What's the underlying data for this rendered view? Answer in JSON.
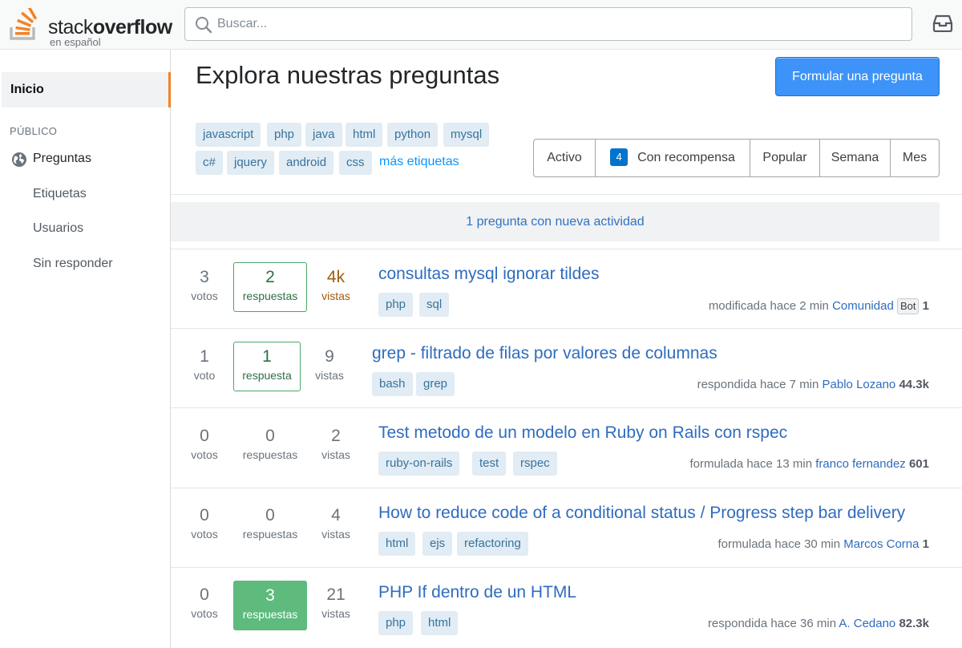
{
  "header": {
    "logo_text_light": "stack",
    "logo_text_bold": "overflow",
    "logo_sub": "en español",
    "search_placeholder": "Buscar...",
    "icons": [
      "search-icon",
      "inbox-icon"
    ]
  },
  "sidebar": {
    "home": "Inicio",
    "section": "PÚBLICO",
    "items": [
      "Preguntas",
      "Etiquetas",
      "Usuarios",
      "Sin responder"
    ]
  },
  "main": {
    "title": "Explora nuestras preguntas",
    "ask_button": "Formular una pregunta",
    "popular_tags": [
      "javascript",
      "php",
      "java",
      "html",
      "python",
      "mysql",
      "c#",
      "jquery",
      "android",
      "css"
    ],
    "more_tags": "más etiquetas",
    "filters": {
      "active": "Activo",
      "bounty_count": "4",
      "bounty": "Con recompensa",
      "popular": "Popular",
      "week": "Semana",
      "month": "Mes"
    },
    "activity_notice": "1 pregunta con nueva actividad",
    "questions": [
      {
        "votes": "3",
        "votes_label": "votos",
        "answers": "2",
        "answers_label": "respuestas",
        "views": "4k",
        "views_label": "vistas",
        "title": "consultas mysql ignorar tildes",
        "tags": [
          "php",
          "sql"
        ],
        "action": "modificada hace 2 min",
        "user": "Comunidad",
        "badge": "Bot",
        "rep": "1"
      },
      {
        "votes": "1",
        "votes_label": "voto",
        "answers": "1",
        "answers_label": "respuesta",
        "views": "9",
        "views_label": "vistas",
        "title": "grep - filtrado de filas por valores de columnas",
        "tags": [
          "bash",
          "grep"
        ],
        "action": "respondida hace 7 min",
        "user": "Pablo Lozano",
        "rep": "44.3k"
      },
      {
        "votes": "0",
        "votes_label": "votos",
        "answers": "0",
        "answers_label": "respuestas",
        "views": "2",
        "views_label": "vistas",
        "title": "Test metodo de un modelo en Ruby on Rails con rspec",
        "tags": [
          "ruby-on-rails",
          "test",
          "rspec"
        ],
        "action": "formulada hace 13 min",
        "user": "franco fernandez",
        "rep": "601"
      },
      {
        "votes": "0",
        "votes_label": "votos",
        "answers": "0",
        "answers_label": "respuestas",
        "views": "4",
        "views_label": "vistas",
        "title": "How to reduce code of a conditional status / Progress step bar delivery",
        "tags": [
          "html",
          "ejs",
          "refactoring"
        ],
        "action": "formulada hace 30 min",
        "user": "Marcos Corna",
        "rep": "1"
      },
      {
        "votes": "0",
        "votes_label": "votos",
        "answers": "3",
        "answers_label": "respuestas",
        "views": "21",
        "views_label": "vistas",
        "title": "PHP If dentro de un HTML",
        "tags": [
          "php",
          "html"
        ],
        "action": "respondida hace 36 min",
        "user": "A. Cedano",
        "rep": "82.3k"
      }
    ]
  },
  "colors": {
    "accent_orange": "#f48225",
    "primary_blue": "#3d93f7",
    "link_blue": "#2f6cbf",
    "tag_bg": "#e1ecf4",
    "accepted_green": "#5eba7d",
    "hot_views": "#a05a0e"
  }
}
